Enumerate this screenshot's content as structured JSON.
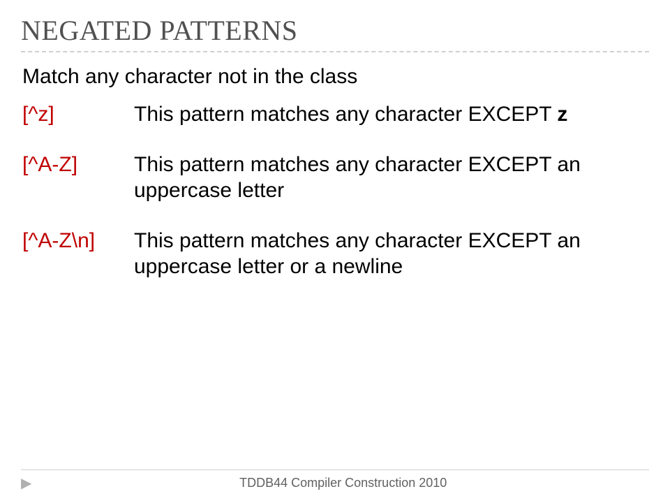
{
  "title": "NEGATED PATTERNS",
  "intro": "Match any character not in the class",
  "patterns": [
    {
      "code": "[^z]",
      "lead": "This pattern matches any character ",
      "except": "EXCEPT",
      "rest": " ",
      "bold": "z",
      "after": ""
    },
    {
      "code": "[^A-Z]",
      "lead": "This pattern matches any character ",
      "except": "EXCEPT",
      "rest": " an uppercase letter",
      "bold": "",
      "after": ""
    },
    {
      "code": "[^A-Z\\n]",
      "lead": "This pattern matches any character ",
      "except": "EXCEPT",
      "rest": " an uppercase letter or a newline",
      "bold": "",
      "after": ""
    }
  ],
  "footer": "TDDB44 Compiler Construction 2010",
  "colors": {
    "pattern": "#c00000",
    "title": "#505050",
    "footer": "#616161"
  }
}
